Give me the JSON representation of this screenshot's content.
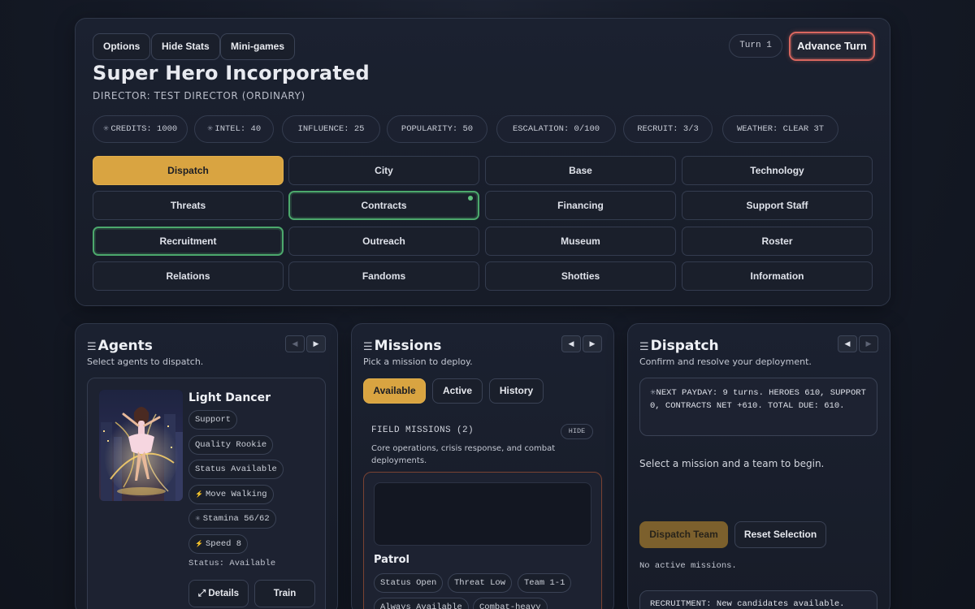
{
  "header": {
    "options_label": "Options",
    "hide_stats_label": "Hide Stats",
    "minigames_label": "Mini-games",
    "turn_label": "Turn 1",
    "advance_label": "Advance Turn",
    "title": "Super Hero Incorporated",
    "director": "DIRECTOR: TEST DIRECTOR (ORDINARY)"
  },
  "stats": [
    {
      "icon": "credits-icon",
      "glyph": "✳",
      "label": "CREDITS: 1000"
    },
    {
      "icon": "intel-icon",
      "glyph": "✳",
      "label": "INTEL: 40"
    },
    {
      "icon": "",
      "glyph": "",
      "label": "INFLUENCE: 25"
    },
    {
      "icon": "",
      "glyph": "",
      "label": "POPULARITY: 50"
    },
    {
      "icon": "",
      "glyph": "",
      "label": "ESCALATION: 0/100"
    },
    {
      "icon": "",
      "glyph": "",
      "label": "RECRUIT: 3/3"
    },
    {
      "icon": "",
      "glyph": "",
      "label": "WEATHER: CLEAR 3T"
    }
  ],
  "nav": [
    [
      "Dispatch",
      "City",
      "Base",
      "Technology"
    ],
    [
      "Threats",
      "Contracts",
      "Financing",
      "Support Staff"
    ],
    [
      "Recruitment",
      "Outreach",
      "Museum",
      "Roster"
    ],
    [
      "Relations",
      "Fandoms",
      "Shotties",
      "Information"
    ]
  ],
  "colors": {
    "accent": "#d9a441",
    "highlight_green": "#4ca86c",
    "alert_red": "#d9675f"
  },
  "agents_panel": {
    "title": "Agents",
    "subtitle": "Select agents to dispatch.",
    "agent": {
      "name": "Light Dancer",
      "tags": [
        "Support",
        "Quality Rookie",
        "Status Available",
        "Move Walking",
        "Stamina 56/62",
        "Speed 8"
      ],
      "status": "Status: Available",
      "details_label": "Details",
      "train_label": "Train"
    }
  },
  "missions_panel": {
    "title": "Missions",
    "subtitle": "Pick a mission to deploy.",
    "tabs": [
      "Available",
      "Active",
      "History"
    ],
    "section_label": "FIELD MISSIONS (2)",
    "hide_label": "HIDE",
    "section_desc": "Core operations, crisis response, and combat deployments.",
    "mission": {
      "name": "Patrol",
      "tags": [
        "Status Open",
        "Threat Low",
        "Team 1-1",
        "Always Available",
        "Combat-heavy"
      ]
    }
  },
  "dispatch_panel": {
    "title": "Dispatch",
    "subtitle": "Confirm and resolve your deployment.",
    "payday": "NEXT PAYDAY: 9 turns. HEROES 610, SUPPORT 0, CONTRACTS NET +610. TOTAL DUE: 610.",
    "hint": "Select a mission and a team to begin.",
    "dispatch_label": "Dispatch Team",
    "reset_label": "Reset Selection",
    "no_active": "No active missions.",
    "recruitment": "RECRUITMENT: New candidates available."
  }
}
